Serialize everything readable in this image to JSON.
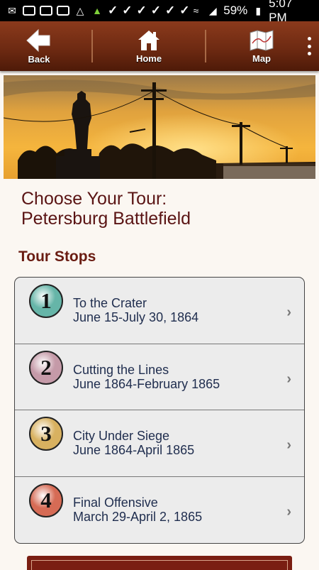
{
  "status_bar": {
    "battery": "59%",
    "time": "5:07 PM"
  },
  "nav": {
    "back_label": "Back",
    "home_label": "Home",
    "map_label": "Map"
  },
  "page": {
    "title_line1": "Choose Your Tour:",
    "title_line2": "Petersburg Battlefield",
    "section_label": "Tour Stops"
  },
  "tour_stops": [
    {
      "number": "1",
      "name": "To the Crater",
      "dates": "June 15-July 30, 1864",
      "badge_color": "#66b5a8"
    },
    {
      "number": "2",
      "name": "Cutting the Lines",
      "dates": "June 1864-February 1865",
      "badge_color": "#c59aa8"
    },
    {
      "number": "3",
      "name": "City Under Siege",
      "dates": "June 1864-April 1865",
      "badge_color": "#d8b160"
    },
    {
      "number": "4",
      "name": "Final Offensive",
      "dates": "March 29-April 2, 1865",
      "badge_color": "#d66b55"
    }
  ],
  "colors": {
    "navbar": "#6e2a12",
    "title": "#5a1414",
    "row_text": "#1f2d4e"
  }
}
